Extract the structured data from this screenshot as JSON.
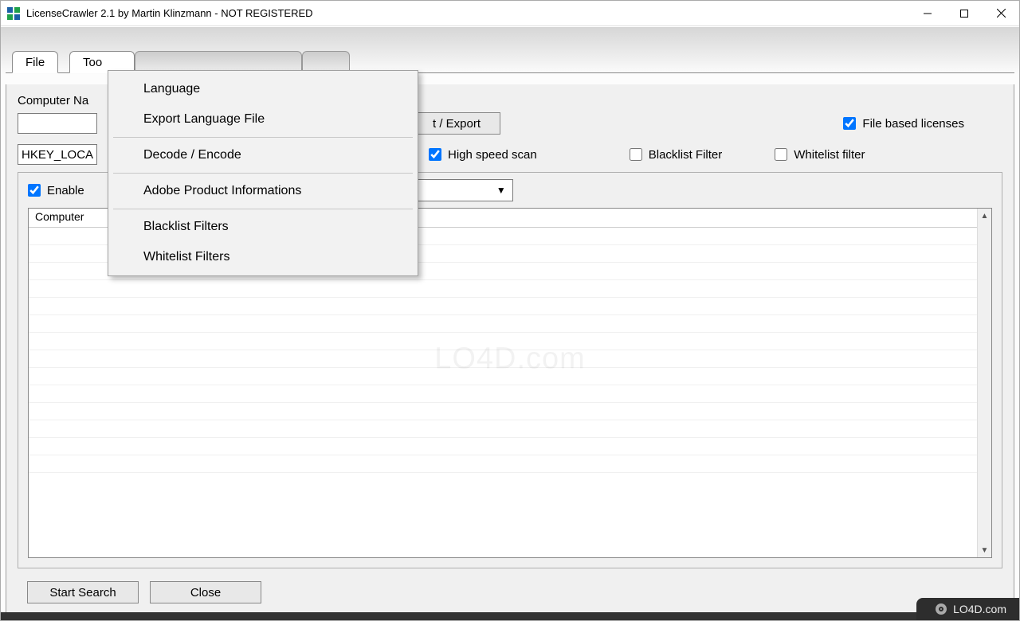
{
  "titlebar": {
    "title": "LicenseCrawler 2.1 by Martin Klinzmann - NOT REGISTERED"
  },
  "menubar": {
    "file": "File",
    "tools": "Too"
  },
  "tools_menu": {
    "items": [
      "Language",
      "Export Language File",
      "Decode / Encode",
      "Adobe Product Informations",
      "Blacklist Filters",
      "Whitelist Filters"
    ]
  },
  "form": {
    "computer_name_label": "Computer Na",
    "computer_name_value": "",
    "import_export_btn": "t / Export",
    "file_based_licenses": "File based licenses",
    "hkey_value": "HKEY_LOCA",
    "high_speed_scan": "High speed scan",
    "blacklist_filter": "Blacklist Filter",
    "whitelist_filter": "Whitelist filter"
  },
  "group": {
    "enable_label": "Enable",
    "combo_value": ""
  },
  "table": {
    "col0": "Computer"
  },
  "buttons": {
    "start_search": "Start Search",
    "close": "Close"
  },
  "watermark": {
    "center": "LO4D.com",
    "corner": "LO4D.com"
  }
}
